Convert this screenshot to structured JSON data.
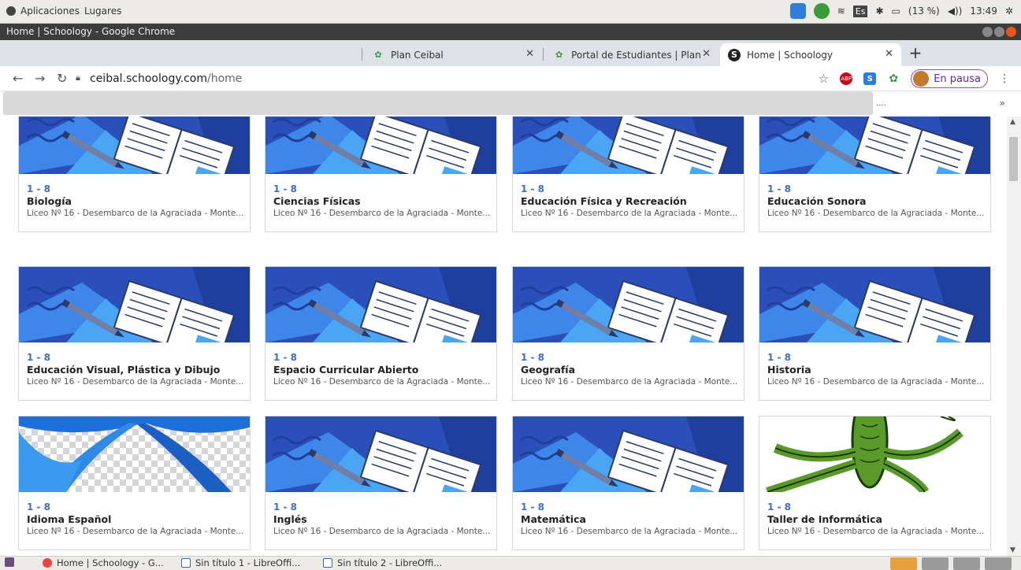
{
  "system_bar": {
    "apps_label": "Aplicaciones",
    "places_label": "Lugares",
    "lang": "Es",
    "battery": "(13 %)",
    "clock": "13:49"
  },
  "window": {
    "title": "Home | Schoology - Google Chrome"
  },
  "tabs": [
    {
      "label": "Plan Ceibal",
      "active": false
    },
    {
      "label": "Portal de Estudiantes | Plan C",
      "active": false
    },
    {
      "label": "Home | Schoology",
      "active": true
    }
  ],
  "address": {
    "host": "ceibal.schoology.com",
    "path": "/home"
  },
  "extensions": {
    "abp": "ABP",
    "s": "S",
    "profile_label": "En pausa"
  },
  "bookmarks": {
    "overflow": "....",
    "more": "»"
  },
  "courses": [
    {
      "section": "1 - 8",
      "name": "Biología",
      "school": "Liceo Nº 16 - Desembarco de la Agraciada - Monte...",
      "image": "book"
    },
    {
      "section": "1 - 8",
      "name": "Ciencias Físicas",
      "school": "Liceo Nº 16 - Desembarco de la Agraciada - Monte...",
      "image": "book"
    },
    {
      "section": "1 - 8",
      "name": "Educación Física y Recreación",
      "school": "Liceo Nº 16 - Desembarco de la Agraciada - Monte...",
      "image": "book"
    },
    {
      "section": "1 - 8",
      "name": "Educación Sonora",
      "school": "Liceo Nº 16 - Desembarco de la Agraciada - Monte...",
      "image": "book"
    },
    {
      "section": "1 - 8",
      "name": "Educación Visual, Plástica y Dibujo",
      "school": "Liceo Nº 16 - Desembarco de la Agraciada - Monte...",
      "image": "book"
    },
    {
      "section": "1 - 8",
      "name": "Espacio Curricular Abierto",
      "school": "Liceo Nº 16 - Desembarco de la Agraciada - Monte...",
      "image": "book"
    },
    {
      "section": "1 - 8",
      "name": "Geografía",
      "school": "Liceo Nº 16 - Desembarco de la Agraciada - Monte...",
      "image": "book"
    },
    {
      "section": "1 - 8",
      "name": "Historia",
      "school": "Liceo Nº 16 - Desembarco de la Agraciada - Monte...",
      "image": "book"
    },
    {
      "section": "1 - 8",
      "name": "Idioma Español",
      "school": "Liceo Nº 16 - Desembarco de la Agraciada - Monte...",
      "image": "ribbon"
    },
    {
      "section": "1 - 8",
      "name": "Inglés",
      "school": "Liceo Nº 16 - Desembarco de la Agraciada - Monte...",
      "image": "book"
    },
    {
      "section": "1 - 8",
      "name": "Matemática",
      "school": "Liceo Nº 16 - Desembarco de la Agraciada - Monte...",
      "image": "book"
    },
    {
      "section": "1 - 8",
      "name": "Taller de Informática",
      "school": "Liceo Nº 16 - Desembarco de la Agraciada - Monte...",
      "image": "lizard"
    }
  ],
  "taskbar": [
    {
      "label": "Home | Schoology - G..."
    },
    {
      "label": "Sin título 1 - LibreOffi..."
    },
    {
      "label": "Sin título 2 - LibreOffi..."
    }
  ],
  "colors": {
    "accent": "#3b6fd1",
    "banner_dark": "#2a4fb8",
    "banner_light": "#4a9bf0"
  }
}
